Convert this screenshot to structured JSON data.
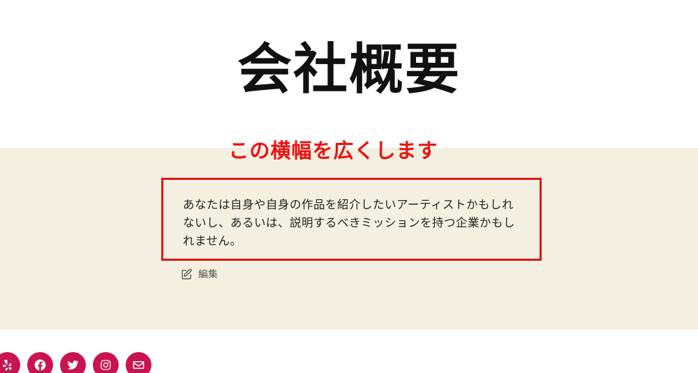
{
  "page": {
    "title": "会社概要"
  },
  "annotation": {
    "text": "この横幅を広くします",
    "color": "#ee1111"
  },
  "content": {
    "paragraph": "あなたは自身や自身の作品を紹介したいアーティストかもしれないし、あるいは、説明するべきミッションを持つ企業かもしれません。",
    "background": "#f4f0e1"
  },
  "edit": {
    "label": "編集",
    "icon": "pencil-square-icon"
  },
  "social": {
    "color": "#c9144f",
    "icons": [
      "yelp-icon",
      "facebook-icon",
      "twitter-icon",
      "instagram-icon",
      "mail-icon"
    ]
  }
}
